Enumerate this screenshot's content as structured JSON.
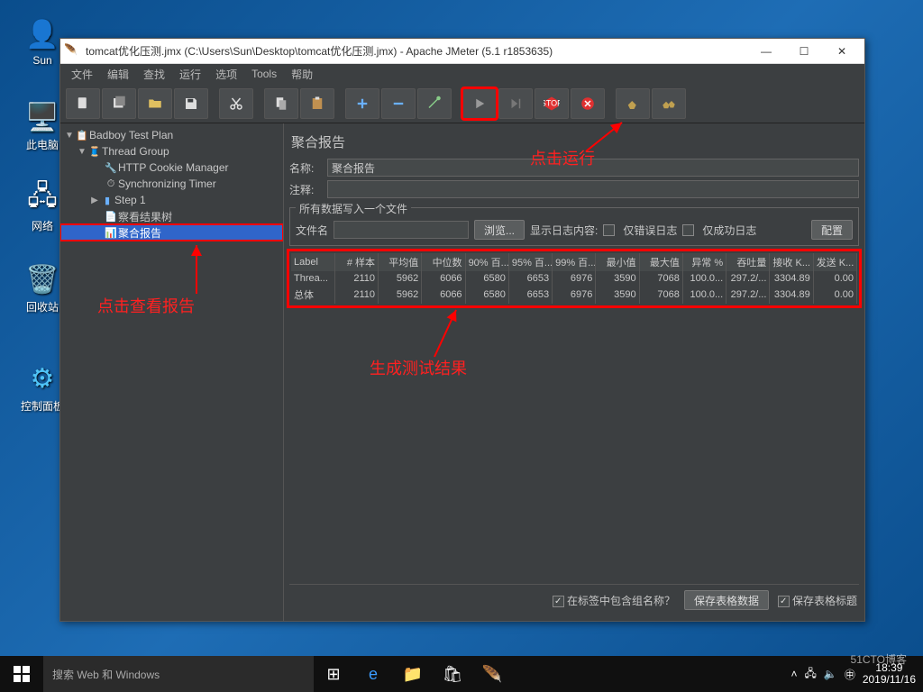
{
  "desktop": {
    "icons": [
      {
        "label": "Sun"
      },
      {
        "label": "此电脑"
      },
      {
        "label": "网络"
      },
      {
        "label": "回收站"
      },
      {
        "label": "控制面板"
      }
    ]
  },
  "window": {
    "title": "tomcat优化压测.jmx (C:\\Users\\Sun\\Desktop\\tomcat优化压测.jmx) - Apache JMeter (5.1 r1853635)"
  },
  "menu": [
    "文件",
    "编辑",
    "查找",
    "运行",
    "选项",
    "Tools",
    "帮助"
  ],
  "tree": {
    "root": "Badboy Test Plan",
    "group": "Thread Group",
    "items": [
      "HTTP Cookie Manager",
      "Synchronizing Timer",
      "Step 1",
      "察看结果树",
      "聚合报告"
    ]
  },
  "panel": {
    "title": "聚合报告",
    "name_label": "名称:",
    "name_value": "聚合报告",
    "comment_label": "注释:",
    "fieldset_title": "所有数据写入一个文件",
    "file_label": "文件名",
    "browse": "浏览...",
    "log_label": "显示日志内容:",
    "only_error": "仅错误日志",
    "only_success": "仅成功日志",
    "configure": "配置"
  },
  "table": {
    "headers": [
      "Label",
      "# 样本",
      "平均值",
      "中位数",
      "90% 百...",
      "95% 百...",
      "99% 百...",
      "最小值",
      "最大值",
      "异常 %",
      "吞吐量",
      "接收 K...",
      "发送 K..."
    ],
    "rows": [
      [
        "Threa...",
        "2110",
        "5962",
        "6066",
        "6580",
        "6653",
        "6976",
        "3590",
        "7068",
        "100.0...",
        "297.2/...",
        "3304.89",
        "0.00"
      ],
      [
        "总体",
        "2110",
        "5962",
        "6066",
        "6580",
        "6653",
        "6976",
        "3590",
        "7068",
        "100.0...",
        "297.2/...",
        "3304.89",
        "0.00"
      ]
    ]
  },
  "footer": {
    "include_group": "在标签中包含组名称？",
    "save_data": "保存表格数据",
    "save_header": "保存表格标题"
  },
  "annotations": {
    "run": "点击运行",
    "view": "点击查看报告",
    "result": "生成测试结果"
  },
  "taskbar": {
    "search_placeholder": "搜索 Web 和 Windows",
    "time": "18:39",
    "date": "2019/11/16",
    "watermark": "51CTO博客"
  }
}
